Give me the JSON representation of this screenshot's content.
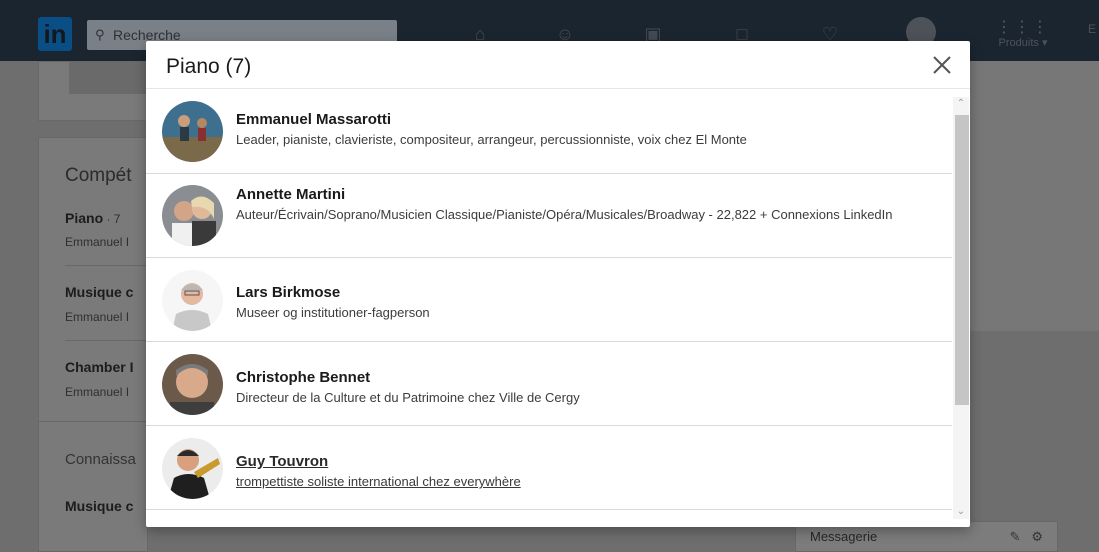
{
  "nav": {
    "logo": "in",
    "search_placeholder": "Recherche",
    "products_label": "Produits ▾",
    "edge_letter": "E"
  },
  "background": {
    "skills_title": "Compét",
    "skill1_name": "Piano",
    "skill1_count": " · 7",
    "skill1_sub": "Emmanuel I",
    "skill2_name": "Musique c",
    "skill2_sub": "Emmanuel I",
    "skill3_name": "Chamber I",
    "skill3_sub": "Emmanuel I",
    "knowledge_title": "Connaissa",
    "skill4_name": "Musique c"
  },
  "messaging": {
    "label": "Messagerie"
  },
  "modal": {
    "title": "Piano (7)",
    "people": [
      {
        "name": "Emmanuel Massarotti",
        "headline": "Leader, pianiste, clavieriste, compositeur, arrangeur, percussionniste, voix chez El Monte"
      },
      {
        "name": "Annette Martini",
        "headline": "Auteur/Écrivain/Soprano/Musicien Classique/Pianiste/Opéra/Musicales/Broadway - 22,822 + Connexions LinkedIn"
      },
      {
        "name": "Lars Birkmose",
        "headline": "Museer og institutioner-fagperson"
      },
      {
        "name": "Christophe Bennet",
        "headline": "Directeur de la Culture et du Patrimoine chez Ville de Cergy"
      },
      {
        "name": "Guy Touvron",
        "headline": "trompettiste soliste international chez everywhère"
      }
    ]
  },
  "colors": {
    "overlay": "#6e6e6e",
    "modal_bg": "#ffffff",
    "divider": "#d9d9d9"
  }
}
